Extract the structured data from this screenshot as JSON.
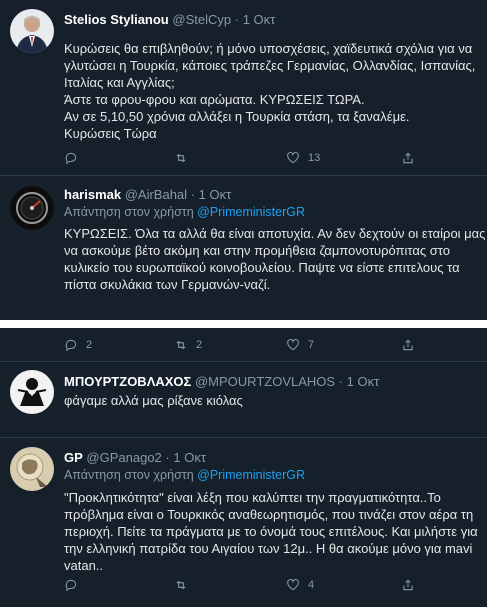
{
  "tweets": [
    {
      "name": "Stelios Stylianou",
      "handle": "@StelCyp",
      "time": "1 Οκτ",
      "lines": [
        "Κυρώσεις θα επιβληθούν; ή μόνο υποσχέσεις, χαϊδευτικά σχόλια για να",
        "γλυτώσει η Τουρκία, κάποιες τράπεζες Γερμανίας, Ολλανδίας, Ισπανίας,",
        "Ιταλίας και Αγγλίας;",
        "Άστε τα φρου-φρου και αρώματα. ΚΥΡΩΣΕΙΣ ΤΩΡΑ.",
        "Αν σε 5,10,50 χρόνια αλλάξει η Τουρκία στάση, τα ξαναλέμε.",
        "Κυρώσεις Τώρα"
      ],
      "counts": {
        "reply": "",
        "retweet": "",
        "like": "13"
      }
    },
    {
      "name": "harismak",
      "handle": "@AirBahal",
      "time": "1 Οκτ",
      "reply_prefix": "Απάντηση στον χρήστη",
      "reply_to": "@PrimeministerGR",
      "lines": [
        "ΚΥΡΩΣΕΙΣ. Όλα τα αλλά θα είναι αποτυχία. Αν δεν δεχτούν οι εταίροι μας",
        "να ασκούμε βέτο ακόμη και στην προμήθεια ζαμπονοτυρόπιτας στο",
        "κυλικείο του ευρωπαϊκού κοινοβουλείου. Παψτε να είστε επιτελους τα",
        "πίστα σκυλάκια των Γερμανών-ναζί."
      ],
      "counts": {
        "reply": "2",
        "retweet": "2",
        "like": "7"
      }
    },
    {
      "name": "ΜΠΟΥΡΤΖΟΒΛΑΧΟΣ",
      "handle": "@MPOURTZOVLAHOS",
      "time": "1 Οκτ",
      "lines": [
        "φάγαμε αλλά μας ρίξανε κιόλας"
      ]
    },
    {
      "name": "GP",
      "handle": "@GPanago2",
      "time": "1 Οκτ",
      "reply_prefix": "Απάντηση στον χρήστη",
      "reply_to": "@PrimeministerGR",
      "lines": [
        "\"Προκλητικότητα\" είναι λέξη που καλύπτει την πραγματικότητα..Το",
        "πρόβλημα είναι ο Τουρκικός αναθεωρητισμός, που τινάζει στον αέρα τη",
        "περιοχή. Πείτε τα πράγματα με το όνομά τους επιτέλους. Και μιλήστε για",
        "την ελληνική πατρίδα του Αιγαίου των 12μ.. Η θα ακούμε μόνο για mavi",
        "vatan.."
      ],
      "counts": {
        "reply": "",
        "retweet": "",
        "like": "4"
      }
    }
  ],
  "colors": {
    "background": "#15202b",
    "text": "#e6e6e6",
    "secondary": "#8899a6",
    "link": "#1da1f2"
  },
  "icons": [
    "reply-icon",
    "retweet-icon",
    "like-icon",
    "share-icon"
  ]
}
